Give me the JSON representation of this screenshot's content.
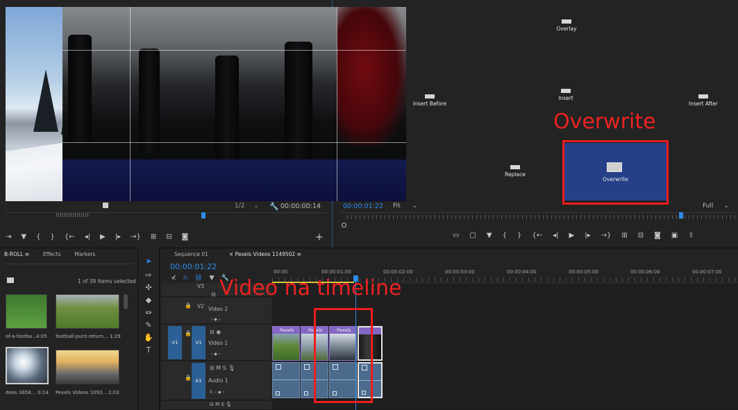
{
  "source_monitor": {
    "zoom": "1/2",
    "timecode": "00:00:00:14"
  },
  "program_monitor": {
    "timecode": "00:00:01:22",
    "fit": "Fit",
    "quality": "Full",
    "drop_zones": {
      "overlay": "Overlay",
      "insert_before": "Insert Before",
      "insert": "Insert",
      "insert_after": "Insert After",
      "replace": "Replace",
      "overwrite": "Overwrite"
    }
  },
  "annotations": {
    "overwrite": "Overwrite",
    "timeline": "Video na timeline",
    "color": "#ee1c1c"
  },
  "project_panel": {
    "tabs": [
      "B-ROLL",
      "Effects",
      "Markers"
    ],
    "count": "1 of 39 items selected",
    "clips": [
      {
        "name": "of-a-footba...",
        "duration": "4:05"
      },
      {
        "name": "football-punt-return...",
        "duration": "1:29"
      },
      {
        "name": "deos 3658...",
        "duration": "0:14"
      },
      {
        "name": "Pexels Videos 1093...",
        "duration": "2:03"
      }
    ]
  },
  "timeline": {
    "tabs": [
      "Sequence 01",
      "Pexels Videos 1149502"
    ],
    "timecode": "00:00:01:22",
    "ruler": [
      {
        "label": "00:00"
      },
      {
        "label": "00:00:01:00"
      },
      {
        "label": "00:00:02:00"
      },
      {
        "label": "00:00:03:00"
      },
      {
        "label": "00:00:04:00"
      },
      {
        "label": "00:00:05:00"
      },
      {
        "label": "00:00:06:00"
      },
      {
        "label": "00:00:07:00"
      }
    ],
    "tracks": {
      "v3": "V3",
      "v2": "V2",
      "v2_name": "Video 2",
      "v1_src": "V1",
      "v1": "V1",
      "v1_name": "Video 1",
      "a1": "A1",
      "a1_name": "Audio 1"
    },
    "clip_label": "Pexels"
  },
  "colors": {
    "accent_blue": "#2d8ceb",
    "video_clip": "#6a4fa5",
    "audio_clip": "#4b6a8c"
  }
}
